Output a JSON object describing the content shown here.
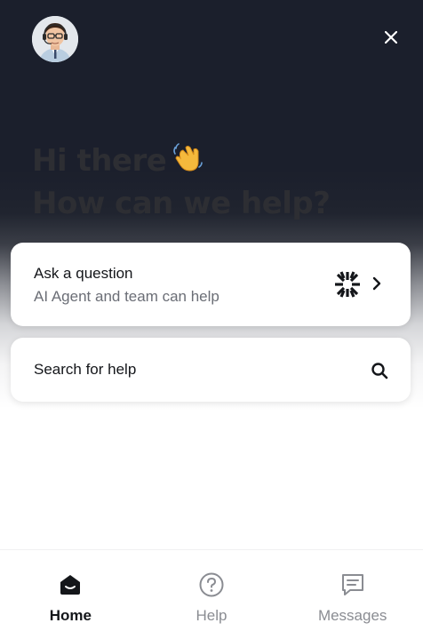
{
  "header": {
    "avatar_icon": "support-agent-avatar",
    "close_icon": "close-icon"
  },
  "greeting": {
    "line1": "Hi there",
    "line2": "How can we help?",
    "emoji": "waving-hand"
  },
  "cards": {
    "ask": {
      "title": "Ask a question",
      "subtitle": "AI Agent and team can help",
      "logo_icon": "ai-agent-logo",
      "chevron_icon": "chevron-right-icon"
    },
    "search": {
      "title": "Search for help",
      "icon": "search-icon"
    }
  },
  "nav": {
    "items": [
      {
        "label": "Home",
        "icon": "home-icon",
        "active": true
      },
      {
        "label": "Help",
        "icon": "help-icon",
        "active": false
      },
      {
        "label": "Messages",
        "icon": "messages-icon",
        "active": false
      }
    ]
  },
  "colors": {
    "hero_dark": "#1b1f2c",
    "text_primary": "#14161a",
    "text_secondary": "#6b6e76",
    "nav_inactive": "#8a8c92"
  }
}
